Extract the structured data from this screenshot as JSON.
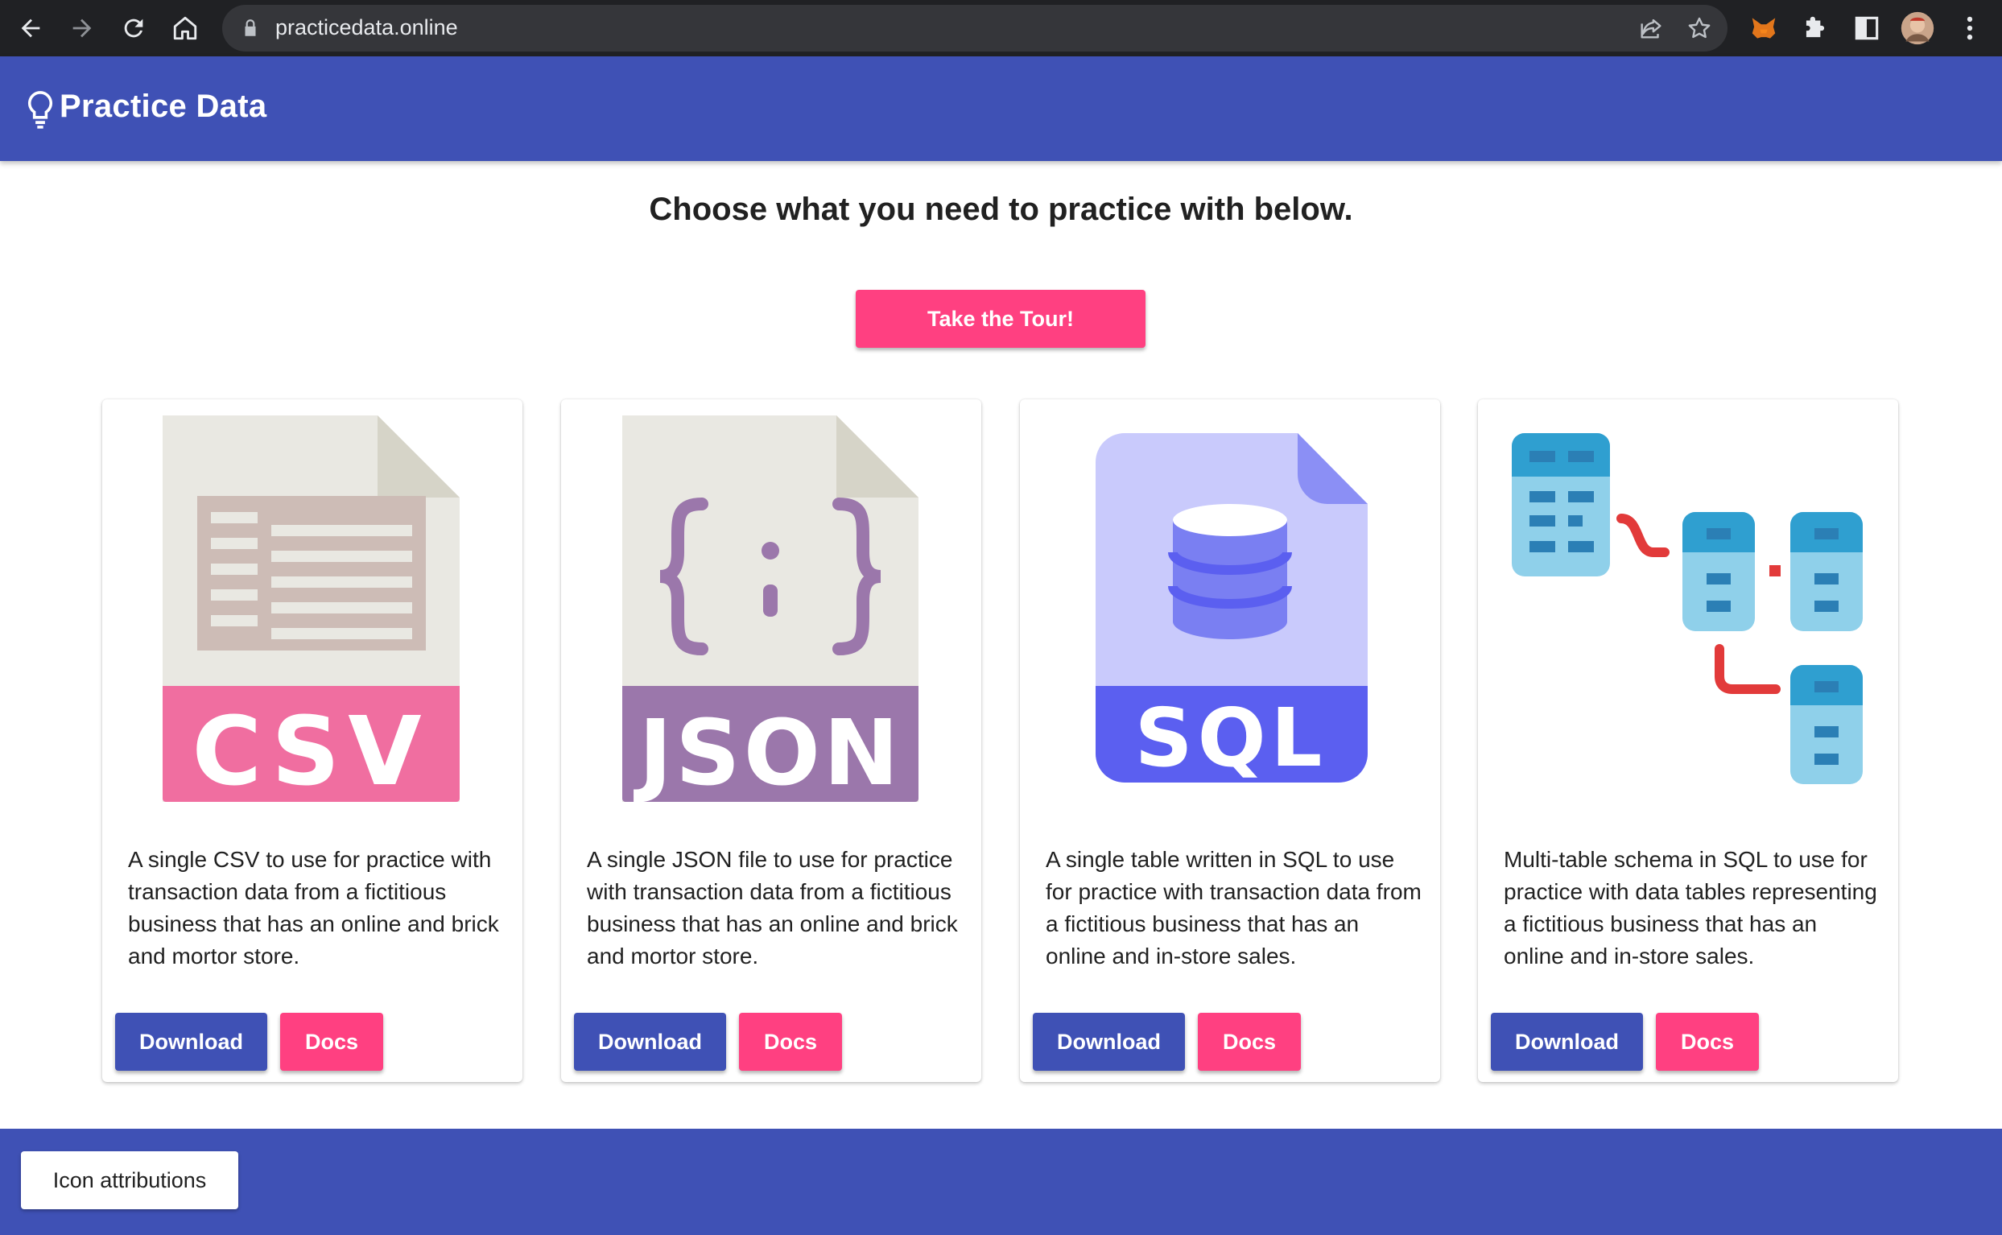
{
  "browser": {
    "url": "practicedata.online",
    "icons": [
      "back-icon",
      "forward-icon",
      "reload-icon",
      "home-icon",
      "lock-icon",
      "share-icon",
      "star-icon",
      "metamask-icon",
      "extensions-icon",
      "side-panel-icon",
      "profile-avatar",
      "menu-icon"
    ]
  },
  "app": {
    "title": "Practice Data",
    "logo_icon": "lightbulb-icon",
    "brand_color": "#3f51b5",
    "accent_color": "#ff4081"
  },
  "main": {
    "headline": "Choose what you need to practice with below.",
    "tour_button": "Take the Tour!"
  },
  "cards": [
    {
      "icon": "csv-file-icon",
      "badge": "CSV",
      "description": "A single CSV to use for practice with transaction data from a fictitious business that has an online and brick and mortor store.",
      "download_label": "Download",
      "docs_label": "Docs"
    },
    {
      "icon": "json-file-icon",
      "badge": "JSON",
      "description": "A single JSON file to use for practice with transaction data from a fictitious business that has an online and brick and mortor store.",
      "download_label": "Download",
      "docs_label": "Docs"
    },
    {
      "icon": "sql-file-icon",
      "badge": "SQL",
      "description": "A single table written in SQL to use for practice with transaction data from a fictitious business that has an online and in-store sales.",
      "download_label": "Download",
      "docs_label": "Docs"
    },
    {
      "icon": "schema-tables-icon",
      "badge": "",
      "description": "Multi-table schema in SQL to use for practice with data tables representing a fictitious business that has an online and in-store sales.",
      "download_label": "Download",
      "docs_label": "Docs"
    }
  ],
  "footer": {
    "attributions_button": "Icon attributions"
  }
}
